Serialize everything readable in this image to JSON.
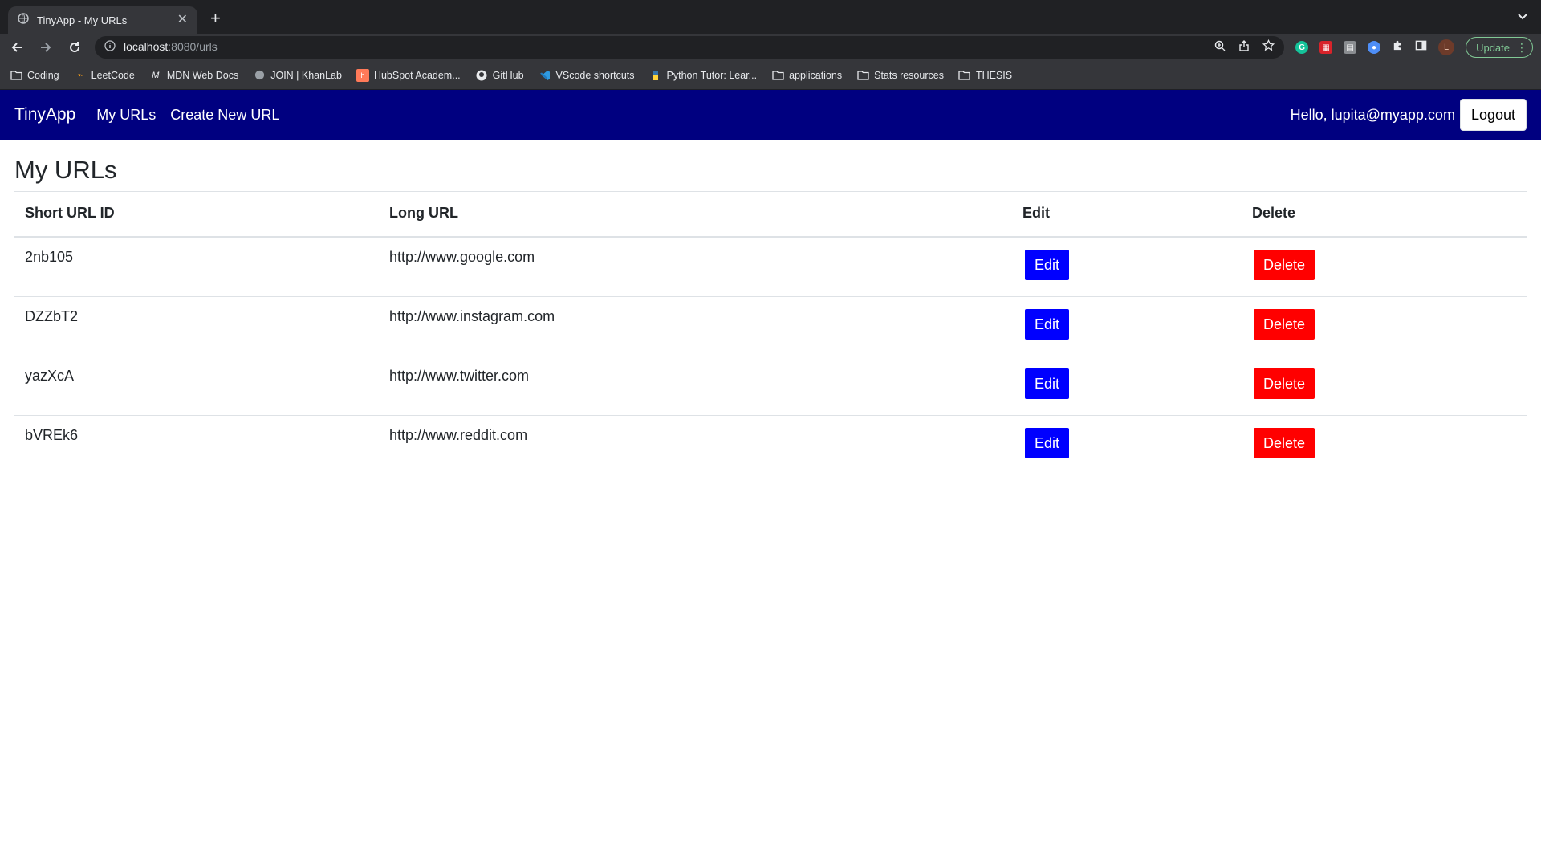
{
  "browser": {
    "tab_title": "TinyApp - My URLs",
    "url_host": "localhost",
    "url_rest": ":8080/urls",
    "update_label": "Update",
    "avatar_letter": "L",
    "bookmarks": [
      {
        "label": "Coding",
        "icon": "folder-icon"
      },
      {
        "label": "LeetCode",
        "icon": "leetcode-icon"
      },
      {
        "label": "MDN Web Docs",
        "icon": "mdn-icon"
      },
      {
        "label": "JOIN | KhanLab",
        "icon": "globe-icon"
      },
      {
        "label": "HubSpot Academ...",
        "icon": "hubspot-icon"
      },
      {
        "label": "GitHub",
        "icon": "github-icon"
      },
      {
        "label": "VScode shortcuts",
        "icon": "vscode-icon"
      },
      {
        "label": "Python Tutor: Lear...",
        "icon": "python-icon"
      },
      {
        "label": "applications",
        "icon": "folder-icon"
      },
      {
        "label": "Stats resources",
        "icon": "folder-icon"
      },
      {
        "label": "THESIS",
        "icon": "folder-icon"
      }
    ]
  },
  "nav": {
    "brand": "TinyApp",
    "my_urls": "My URLs",
    "create_new": "Create New URL",
    "greeting": "Hello, lupita@myapp.com",
    "logout": "Logout"
  },
  "main": {
    "title": "My URLs",
    "headers": [
      "Short URL ID",
      "Long URL",
      "Edit",
      "Delete"
    ],
    "rows": [
      {
        "short": "2nb105",
        "long": "http://www.google.com"
      },
      {
        "short": "DZZbT2",
        "long": "http://www.instagram.com"
      },
      {
        "short": "yazXcA",
        "long": "http://www.twitter.com"
      },
      {
        "short": "bVREk6",
        "long": "http://www.reddit.com"
      }
    ],
    "edit_label": "Edit",
    "delete_label": "Delete"
  },
  "colors": {
    "navbar": "#000080",
    "edit_button": "#0000ff",
    "delete_button": "#ff0000"
  }
}
